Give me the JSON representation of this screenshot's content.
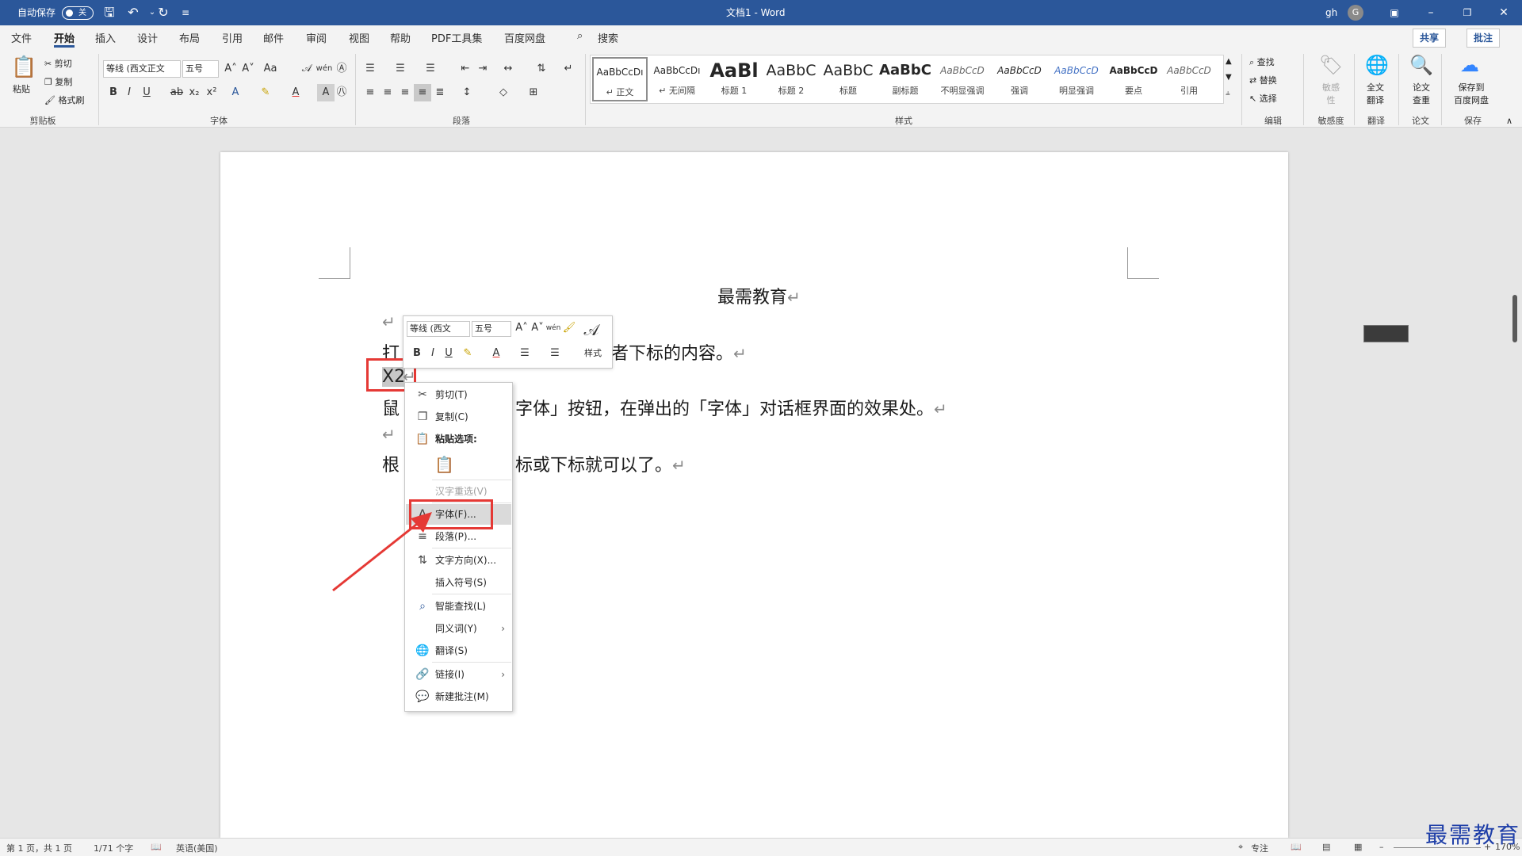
{
  "titlebar": {
    "autosave_label": "自动保存",
    "autosave_state": "关",
    "doc_title": "文档1  -  Word",
    "user": "gh",
    "avatar_letter": "G"
  },
  "tabs": [
    "文件",
    "开始",
    "插入",
    "设计",
    "布局",
    "引用",
    "邮件",
    "审阅",
    "视图",
    "帮助",
    "PDF工具集",
    "百度网盘"
  ],
  "search_label": "搜索",
  "share_label": "共享",
  "comment_label": "批注",
  "clipboard": {
    "paste": "粘贴",
    "cut": "剪切",
    "copy": "复制",
    "format_painter": "格式刷",
    "group": "剪贴板"
  },
  "font": {
    "name": "等线 (西文正文",
    "size": "五号",
    "group": "字体"
  },
  "paragraph_group": "段落",
  "styles": {
    "group": "样式",
    "items": [
      {
        "sample": "AaBbCcDı",
        "name": "↵ 正文"
      },
      {
        "sample": "AaBbCcDı",
        "name": "↵ 无间隔"
      },
      {
        "sample": "AaBl",
        "name": "标题 1"
      },
      {
        "sample": "AaBbC",
        "name": "标题 2"
      },
      {
        "sample": "AaBbC",
        "name": "标题"
      },
      {
        "sample": "AaBbC",
        "name": "副标题"
      },
      {
        "sample": "AaBbCcD",
        "name": "不明显强调"
      },
      {
        "sample": "AaBbCcD",
        "name": "强调"
      },
      {
        "sample": "AaBbCcD",
        "name": "明显强调"
      },
      {
        "sample": "AaBbCcD",
        "name": "要点"
      },
      {
        "sample": "AaBbCcD",
        "name": "引用"
      }
    ]
  },
  "editing": {
    "find": "查找",
    "replace": "替换",
    "select": "选择",
    "group": "编辑"
  },
  "sensitivity": {
    "label": "敏感\n性",
    "group": "敏感度"
  },
  "translate": {
    "label": "全文\n翻译",
    "group": "翻译"
  },
  "paper": {
    "label": "论文\n查重",
    "group": "论文"
  },
  "save_group": {
    "label": "保存到\n百度网盘",
    "group": "保存"
  },
  "document": {
    "title": "最需教育",
    "line1_start": "打",
    "line1_end": "者下标的内容。",
    "x2": "X2",
    "line3_start": "鼠",
    "line3_end": "字体」按钮，在弹出的「字体」对话框界面的效果处。",
    "line4_start": "根",
    "line4_end": "标或下标就可以了。"
  },
  "mini_toolbar": {
    "font": "等线 (西文",
    "size": "五号",
    "styles": "样式"
  },
  "context_menu": {
    "cut": "剪切(T)",
    "copy": "复制(C)",
    "paste_options": "粘贴选项:",
    "reconvert": "汉字重选(V)",
    "font": "字体(F)...",
    "paragraph": "段落(P)...",
    "text_direction": "文字方向(X)...",
    "insert_symbol": "插入符号(S)",
    "smart_lookup": "智能查找(L)",
    "synonyms": "同义词(Y)",
    "translate": "翻译(S)",
    "link": "链接(I)",
    "new_comment": "新建批注(M)"
  },
  "statusbar": {
    "page": "第 1 页，共 1 页",
    "words": "1/71 个字",
    "language": "英语(美国)",
    "focus": "专注",
    "zoom": "170%"
  },
  "watermark": "最需教育",
  "colors": {
    "titlebar": "#2b579a",
    "highlight": "#e53935"
  }
}
